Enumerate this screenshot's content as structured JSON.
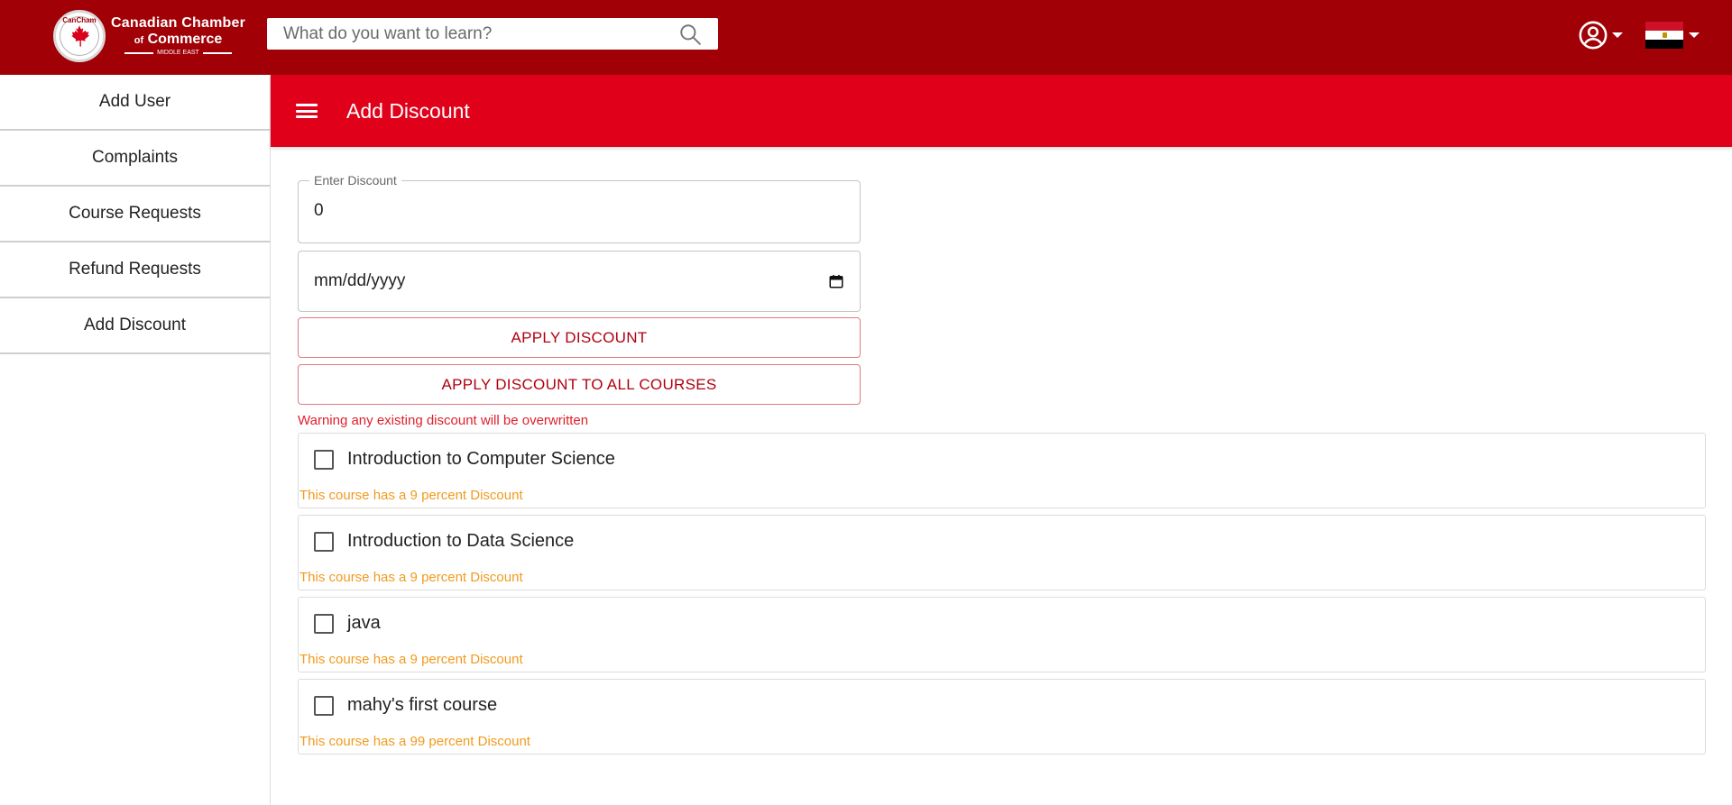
{
  "header": {
    "logo": {
      "line1": "Canadian Chamber",
      "line2_of": "of",
      "line2": "Commerce",
      "line3": "MIDDLE EAST",
      "seal_text": "CanCham"
    },
    "search": {
      "placeholder": "What do you want to learn?",
      "value": ""
    },
    "icons": {
      "search": "search-icon",
      "user": "account-circle-icon",
      "flag": "egypt-flag-icon"
    }
  },
  "sidebar": {
    "items": [
      {
        "label": "Add User"
      },
      {
        "label": "Complaints"
      },
      {
        "label": "Course Requests"
      },
      {
        "label": "Refund Requests"
      },
      {
        "label": "Add Discount"
      }
    ]
  },
  "page": {
    "title": "Add Discount",
    "discount_field": {
      "label": "Enter Discount",
      "value": "0"
    },
    "date_field": {
      "placeholder": "mm/dd/yyyy"
    },
    "apply_button": "APPLY DISCOUNT",
    "apply_all_button": "APPLY DISCOUNT TO ALL COURSES",
    "warning": "Warning any existing discount will be overwritten"
  },
  "courses": [
    {
      "name": "Introduction to Computer Science",
      "note": "This course has a 9 percent Discount",
      "checked": false
    },
    {
      "name": "Introduction to Data Science",
      "note": "This course has a 9 percent Discount",
      "checked": false
    },
    {
      "name": "java",
      "note": "This course has a 9 percent Discount",
      "checked": false
    },
    {
      "name": "mahy's first course",
      "note": "This course has a 99 percent Discount",
      "checked": false
    }
  ],
  "colors": {
    "topbar": "#a00006",
    "page_header": "#e0001a",
    "accent_text": "#b0000f",
    "warning": "#e01f2c",
    "note": "#f29a1e"
  }
}
